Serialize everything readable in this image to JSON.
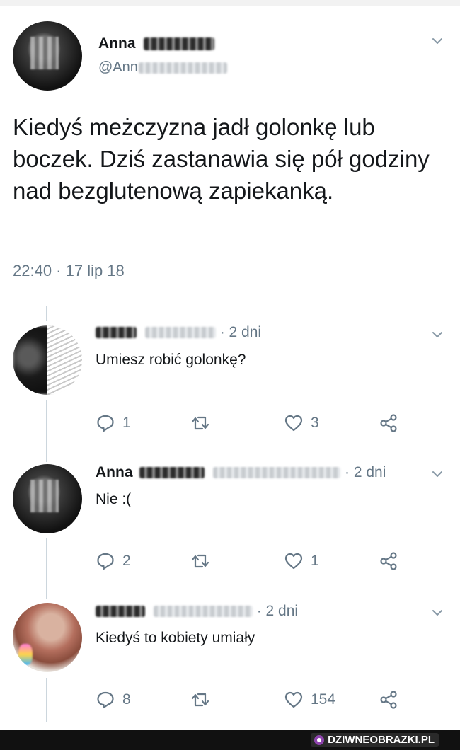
{
  "main_tweet": {
    "author_name": "Anna",
    "handle_prefix": "@Ann",
    "text": "Kiedyś meżczyzna jadł golonkę lub boczek. Dziś zastanawia się pół godziny nad bezglutenową zapiekanką.",
    "timestamp": "22:40 · 17 lip 18"
  },
  "replies": [
    {
      "time": "· 2 dni",
      "text": "Umiesz robić golonkę?",
      "reply_count": "1",
      "retweet_count": "",
      "like_count": "3"
    },
    {
      "author_name": "Anna",
      "time": "· 2 dni",
      "text": "Nie :(",
      "reply_count": "2",
      "retweet_count": "",
      "like_count": "1"
    },
    {
      "time": "· 2 dni",
      "text": "Kiedyś to kobiety umiały",
      "reply_count": "8",
      "retweet_count": "",
      "like_count": "154"
    }
  ],
  "watermark": {
    "brand": "DZIWNEOBRAZKI.PL"
  },
  "icons": {
    "menu": "chevron-down-icon",
    "reply": "reply-icon",
    "retweet": "retweet-icon",
    "like": "heart-icon",
    "share": "share-icon"
  },
  "colors": {
    "text": "#14171a",
    "secondary": "#657786",
    "thread_line": "#ccd6dd",
    "footer": "#111111"
  }
}
